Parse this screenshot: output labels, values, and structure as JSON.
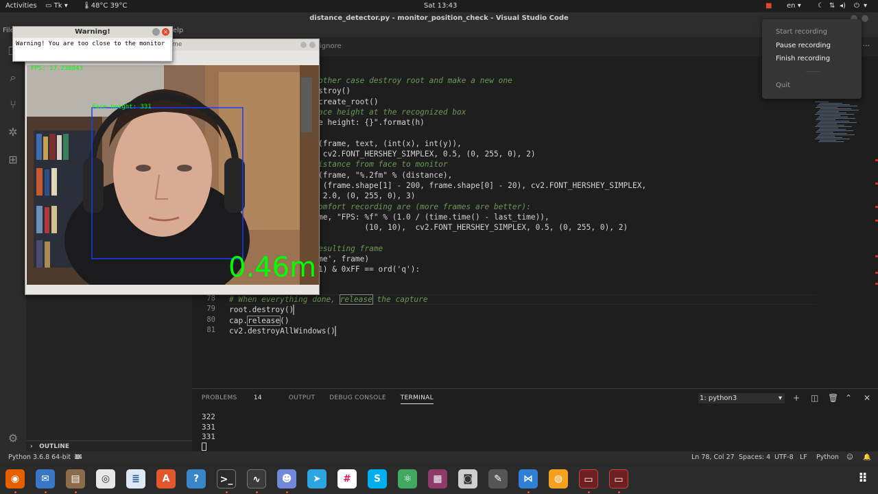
{
  "topbar": {
    "activities": "Activities",
    "app_menu": "Tk",
    "temps": "48°C 39°C",
    "clock": "Sat 13:43",
    "lang": "en"
  },
  "window_title": "distance_detector.py - monitor_position_check - Visual Studio Code",
  "menubar": {
    "file": "File",
    "help_fragment": "elp"
  },
  "tab": {
    "label_fragment": "ignore",
    "more": "···"
  },
  "code_lines": [
    {
      "text": "other case destroy root and make a new one",
      "kind": "comment"
    },
    {
      "text": "stroy()",
      "kind": "code"
    },
    {
      "text": "create_root()",
      "kind": "code"
    },
    {
      "text": "ace height at the recognized box",
      "kind": "comment"
    },
    {
      "text": "e height: {}\".format(h)",
      "kind": "code"
    },
    {
      "text": "",
      "kind": "code"
    },
    {
      "text": "(frame, text, (int(x), int(y)),",
      "kind": "code"
    },
    {
      "text": " cv2.FONT_HERSHEY_SIMPLEX, 0.5, (0, 255, 0), 2)",
      "kind": "code"
    },
    {
      "text": "istance from face to monitor",
      "kind": "comment"
    },
    {
      "text": "(frame, \"%.2fm\" % (distance),",
      "kind": "code"
    },
    {
      "text": " (frame.shape[1] - 200, frame.shape[0] - 20), cv2.FONT_HERSHEY_SIMPLEX,",
      "kind": "code"
    },
    {
      "text": " 2.0, (0, 255, 0), 3)",
      "kind": "code"
    },
    {
      "text": "omfort recording are (more frames are better):",
      "kind": "comment"
    },
    {
      "text": "me, \"FPS: %f\" % (1.0 / (time.time() - last_time)),",
      "kind": "code"
    },
    {
      "text": "          (10, 10),  cv2.FONT_HERSHEY_SIMPLEX, 0.5, (0, 255, 0), 2)",
      "kind": "code"
    },
    {
      "text": "",
      "kind": "code"
    },
    {
      "text": "esulting frame",
      "kind": "comment"
    },
    {
      "text": "me', frame)",
      "kind": "code"
    },
    {
      "text": "1) & 0xFF == ord('q'):",
      "kind": "code"
    }
  ],
  "numbered_lines": [
    {
      "num": "78",
      "pre": "# When everything done, ",
      "boxed": "release",
      "post": " the capture",
      "kind": "comment"
    },
    {
      "num": "79",
      "pre": "root.destroy()",
      "boxed": "",
      "post": "",
      "kind": "code"
    },
    {
      "num": "80",
      "pre": "cap.",
      "boxed": "release",
      "post": "()",
      "kind": "code"
    },
    {
      "num": "81",
      "pre": "cv2.destroyAllWindows()",
      "boxed": "",
      "post": "",
      "kind": "code"
    }
  ],
  "panel": {
    "tabs": [
      "PROBLEMS",
      "OUTPUT",
      "DEBUG CONSOLE",
      "TERMINAL"
    ],
    "problems_count": "14",
    "terminal_select": "1: python3",
    "terminal_lines": [
      "322",
      "331",
      "331"
    ]
  },
  "sidebar": {
    "outline": "OUTLINE"
  },
  "statusbar": {
    "python": "Python 3.6.8 64-bit",
    "errors": "14",
    "warnings": "0",
    "position": "Ln 78, Col 27",
    "spaces": "Spaces: 4",
    "encoding": "UTF-8",
    "eol": "LF",
    "language": "Python"
  },
  "warning_window": {
    "title": "Warning!",
    "message": "Warning! You are too close to the monitor"
  },
  "frame_window": {
    "title_fragment": "me",
    "fps_text": "FPS: 17.238843",
    "face_height": "Face height: 331",
    "distance": "0.46m"
  },
  "recording_menu": {
    "start": "Start recording",
    "pause": "Pause recording",
    "finish": "Finish recording",
    "quit": "Quit"
  },
  "colors": {
    "accent_red": "#e95420",
    "green_overlay": "#00ff00",
    "box_blue": "#1a3cff"
  }
}
